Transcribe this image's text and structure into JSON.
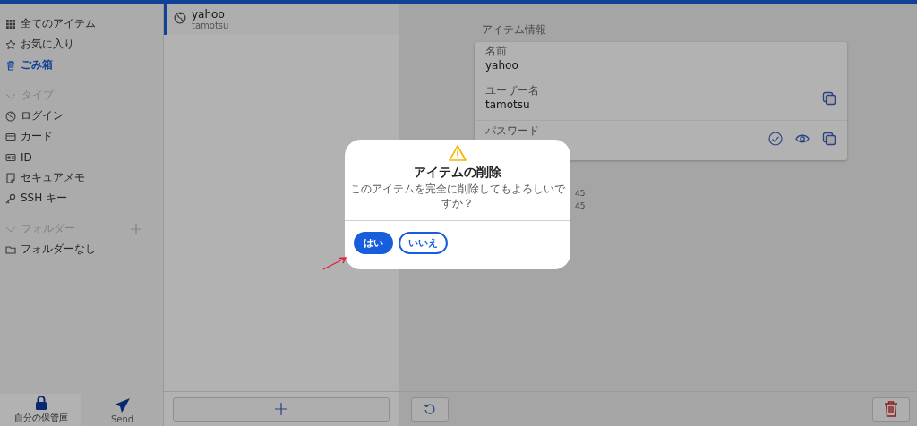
{
  "sidebar": {
    "items": [
      {
        "label": "全てのアイテム",
        "selected": false
      },
      {
        "label": "お気に入り",
        "selected": false
      },
      {
        "label": "ごみ箱",
        "selected": true
      }
    ],
    "types": {
      "header": "タイプ",
      "items": [
        {
          "label": "ログイン",
          "selected": false
        },
        {
          "label": "カード",
          "selected": false
        },
        {
          "label": "ID",
          "selected": false
        },
        {
          "label": "セキュアメモ",
          "selected": false
        },
        {
          "label": "SSH キー",
          "selected": false
        }
      ]
    },
    "folders": {
      "header": "フォルダー",
      "items": [
        {
          "label": "フォルダーなし",
          "selected": false
        }
      ]
    },
    "nav": [
      {
        "label": "自分の保管庫",
        "selected": true
      },
      {
        "label": "Send",
        "selected": false
      }
    ]
  },
  "vault_list": {
    "items": [
      {
        "name": "yahoo",
        "username": "tamotsu",
        "selected": true
      }
    ]
  },
  "detail": {
    "section_title": "アイテム情報",
    "fields": [
      {
        "kind": "name",
        "label": "名前",
        "value": "yahoo"
      },
      {
        "kind": "username",
        "label": "ユーザー名",
        "value": "tamotsu"
      },
      {
        "kind": "password",
        "label": "パスワード"
      }
    ],
    "history": [
      "45",
      "45"
    ]
  },
  "dialog": {
    "title": "アイテムの削除",
    "message": "このアイテムを完全に削除してもよろしいですか？",
    "buttons": [
      {
        "label": "はい",
        "kind": "primary"
      },
      {
        "label": "いいえ",
        "kind": "secondary"
      }
    ]
  }
}
